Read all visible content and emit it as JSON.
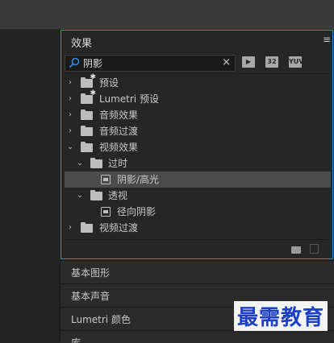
{
  "panel": {
    "title": "效果",
    "menu_icon": "≡"
  },
  "search": {
    "value": "阴影",
    "clear_icon": "×"
  },
  "filters": [
    {
      "name": "accelerated-filter",
      "label": ""
    },
    {
      "name": "32bit-filter",
      "label": "32"
    },
    {
      "name": "yuv-filter",
      "label": "YUV"
    }
  ],
  "tree": [
    {
      "label": "预设",
      "depth": 0,
      "expanded": false,
      "icon": "folder-star"
    },
    {
      "label": "Lumetri 预设",
      "depth": 0,
      "expanded": false,
      "icon": "folder-star"
    },
    {
      "label": "音频效果",
      "depth": 0,
      "expanded": false,
      "icon": "folder"
    },
    {
      "label": "音频过渡",
      "depth": 0,
      "expanded": false,
      "icon": "folder"
    },
    {
      "label": "视频效果",
      "depth": 0,
      "expanded": true,
      "icon": "folder"
    },
    {
      "label": "过时",
      "depth": 1,
      "expanded": true,
      "icon": "folder"
    },
    {
      "label": "阴影/高光",
      "depth": 2,
      "icon": "effect",
      "selected": true
    },
    {
      "label": "透视",
      "depth": 1,
      "expanded": true,
      "icon": "folder"
    },
    {
      "label": "径向阴影",
      "depth": 2,
      "icon": "effect"
    },
    {
      "label": "视频过渡",
      "depth": 0,
      "expanded": false,
      "icon": "folder"
    }
  ],
  "stacked_panels": [
    "基本图形",
    "基本声音",
    "Lumetri 颜色",
    "库"
  ],
  "watermark": "最需教育",
  "colors": {
    "accent_border": "#2d8ceb",
    "selected_row": "#4b4b4b",
    "watermark": "#1a3ec8"
  }
}
